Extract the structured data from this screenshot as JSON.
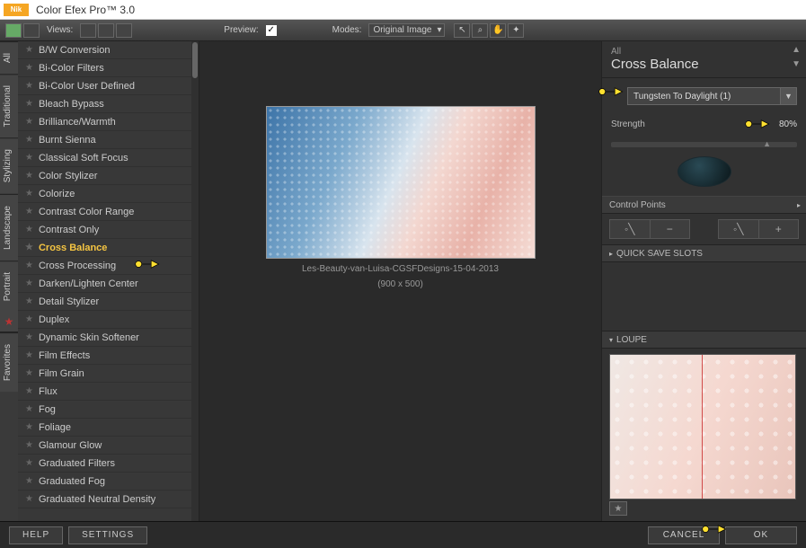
{
  "app": {
    "title": "Color Efex Pro™ 3.0",
    "logo_text": "Nik"
  },
  "toolbar": {
    "views_label": "Views:",
    "preview_label": "Preview:",
    "preview_checked": "✓",
    "modes_label": "Modes:",
    "modes_value": "Original Image"
  },
  "side_tabs": [
    "All",
    "Traditional",
    "Stylizing",
    "Landscape",
    "Portrait",
    "Favorites"
  ],
  "filters": [
    "B/W Conversion",
    "Bi-Color Filters",
    "Bi-Color User Defined",
    "Bleach Bypass",
    "Brilliance/Warmth",
    "Burnt Sienna",
    "Classical Soft Focus",
    "Color Stylizer",
    "Colorize",
    "Contrast Color Range",
    "Contrast Only",
    "Cross Balance",
    "Cross Processing",
    "Darken/Lighten Center",
    "Detail Stylizer",
    "Duplex",
    "Dynamic Skin Softener",
    "Film Effects",
    "Film Grain",
    "Flux",
    "Fog",
    "Foliage",
    "Glamour Glow",
    "Graduated Filters",
    "Graduated Fog",
    "Graduated Neutral Density"
  ],
  "active_filter_index": 11,
  "preview": {
    "filename": "Les-Beauty-van-Luisa-CGSFDesigns-15-04-2013",
    "dimensions": "(900 x 500)"
  },
  "right": {
    "category": "All",
    "filter_name": "Cross Balance",
    "preset_value": "Tungsten To Daylight (1)",
    "strength_label": "Strength",
    "strength_value": "80%",
    "control_points_label": "Control Points",
    "quick_save_label": "QUICK SAVE SLOTS",
    "loupe_label": "LOUPE"
  },
  "footer": {
    "help": "HELP",
    "settings": "SETTINGS",
    "cancel": "CANCEL",
    "ok": "OK"
  }
}
